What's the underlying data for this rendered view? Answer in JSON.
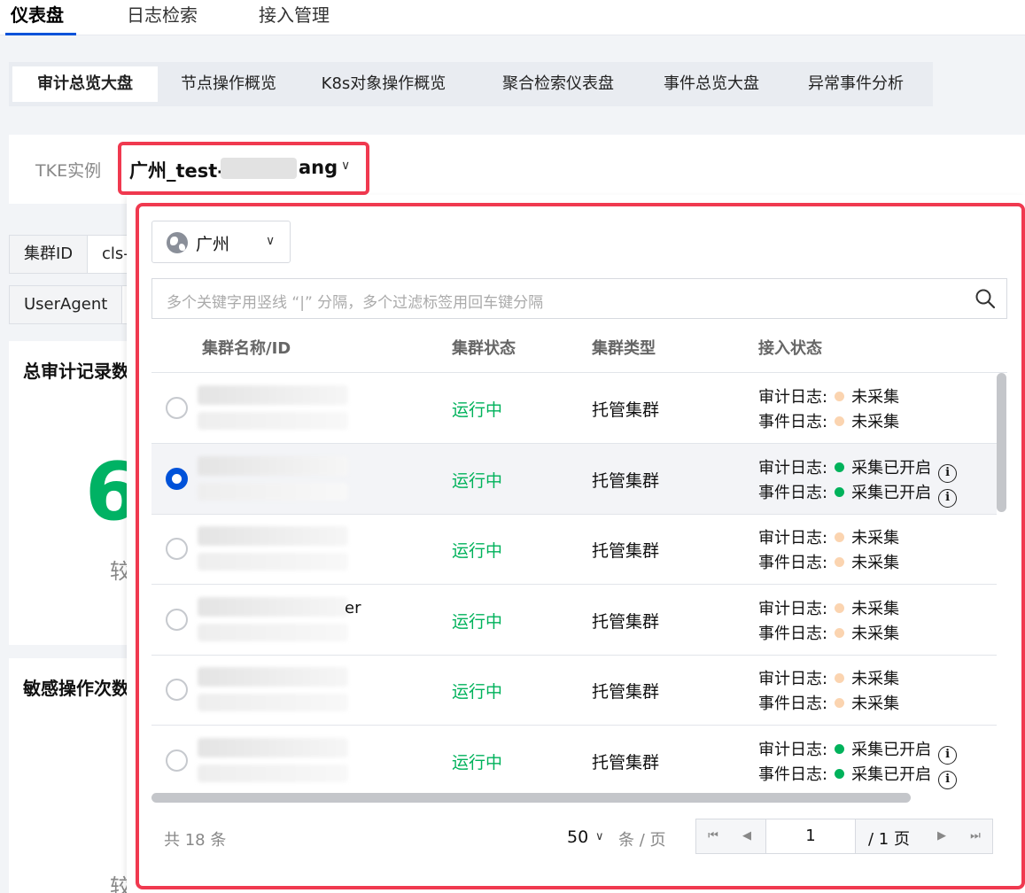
{
  "top_nav": {
    "tabs": [
      {
        "label": "仪表盘",
        "active": true
      },
      {
        "label": "日志检索",
        "active": false
      },
      {
        "label": "接入管理",
        "active": false
      }
    ]
  },
  "sub_tabs": [
    {
      "label": "审计总览大盘",
      "active": true
    },
    {
      "label": "节点操作概览",
      "active": false
    },
    {
      "label": "K8s对象操作概览",
      "active": false
    },
    {
      "label": "聚合检索仪表盘",
      "active": false
    },
    {
      "label": "事件总览大盘",
      "active": false
    },
    {
      "label": "异常事件分析",
      "active": false
    }
  ],
  "tke": {
    "label": "TKE实例",
    "value_prefix": "广州_test-",
    "value_suffix": "ang"
  },
  "background": {
    "filters": [
      {
        "key": "集群ID",
        "value": "cls-"
      },
      {
        "key": "UserAgent",
        "value": ""
      }
    ],
    "cards": [
      {
        "title": "总审计记录数",
        "big": "6",
        "sub": "较"
      },
      {
        "title": "敏感操作次数",
        "big": "",
        "sub": "较"
      }
    ]
  },
  "panel": {
    "region": "广州",
    "search_placeholder": "多个关键字用竖线 “|” 分隔，多个过滤标签用回车键分隔",
    "columns": [
      "集群名称/ID",
      "集群状态",
      "集群类型",
      "接入状态"
    ],
    "rows": [
      {
        "selected": false,
        "name_suffix": "",
        "status": "运行中",
        "type": "托管集群",
        "audit_label": "审计日志:",
        "audit": "未采集",
        "audit_on": false,
        "event_label": "事件日志:",
        "event": "未采集",
        "event_on": false
      },
      {
        "selected": true,
        "name_suffix": "",
        "status": "运行中",
        "type": "托管集群",
        "audit_label": "审计日志:",
        "audit": "采集已开启",
        "audit_on": true,
        "event_label": "事件日志:",
        "event": "采集已开启",
        "event_on": true
      },
      {
        "selected": false,
        "name_suffix": "",
        "status": "运行中",
        "type": "托管集群",
        "audit_label": "审计日志:",
        "audit": "未采集",
        "audit_on": false,
        "event_label": "事件日志:",
        "event": "未采集",
        "event_on": false
      },
      {
        "selected": false,
        "name_suffix": "er",
        "status": "运行中",
        "type": "托管集群",
        "audit_label": "审计日志:",
        "audit": "未采集",
        "audit_on": false,
        "event_label": "事件日志:",
        "event": "未采集",
        "event_on": false
      },
      {
        "selected": false,
        "name_suffix": "",
        "status": "运行中",
        "type": "托管集群",
        "audit_label": "审计日志:",
        "audit": "未采集",
        "audit_on": false,
        "event_label": "事件日志:",
        "event": "未采集",
        "event_on": false
      },
      {
        "selected": false,
        "name_suffix": "",
        "status": "运行中",
        "type": "托管集群",
        "audit_label": "审计日志:",
        "audit": "采集已开启",
        "audit_on": true,
        "event_label": "事件日志:",
        "event": "采集已开启",
        "event_on": true
      }
    ],
    "info_glyph": "i",
    "pagination": {
      "total": "共 18 条",
      "page_size": "50",
      "page_size_unit": "条 / 页",
      "current_page": "1",
      "total_pages": "/ 1 页"
    }
  },
  "colors": {
    "highlight": "#f0394f",
    "accent": "#0052d9",
    "running": "#00b25b",
    "not_collected_dot": "#fbd4b0"
  }
}
